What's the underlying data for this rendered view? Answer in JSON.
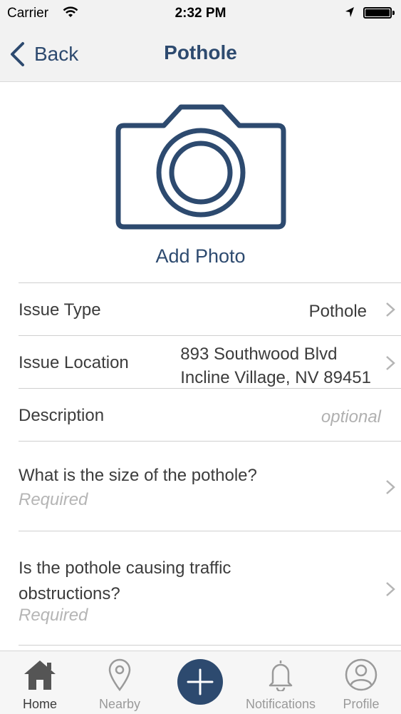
{
  "status_bar": {
    "carrier": "Carrier",
    "time": "2:32 PM"
  },
  "nav": {
    "back_label": "Back",
    "title": "Pothole"
  },
  "photo": {
    "add_label": "Add Photo"
  },
  "form": {
    "issue_type": {
      "label": "Issue Type",
      "value": "Pothole"
    },
    "issue_location": {
      "label": "Issue Location",
      "line1": "893 Southwood Blvd",
      "line2": "Incline Village, NV 89451"
    },
    "description": {
      "label": "Description",
      "placeholder": "optional"
    },
    "pothole_size": {
      "question": "What is the size of the pothole?",
      "status": "Required"
    },
    "traffic": {
      "question_line1": "Is the pothole causing traffic",
      "question_line2": "obstructions?",
      "status": "Required"
    }
  },
  "tabs": [
    {
      "label": "Home",
      "icon": "home-icon",
      "active": true
    },
    {
      "label": "Nearby",
      "icon": "location-pin-icon"
    },
    {
      "label": "",
      "icon": "plus-icon"
    },
    {
      "label": "Notifications",
      "icon": "bell-icon"
    },
    {
      "label": "Profile",
      "icon": "profile-icon"
    }
  ],
  "colors": {
    "accent": "#2d4a6f",
    "placeholder": "#b0b0b0",
    "bar_background": "#f2f2f2"
  }
}
